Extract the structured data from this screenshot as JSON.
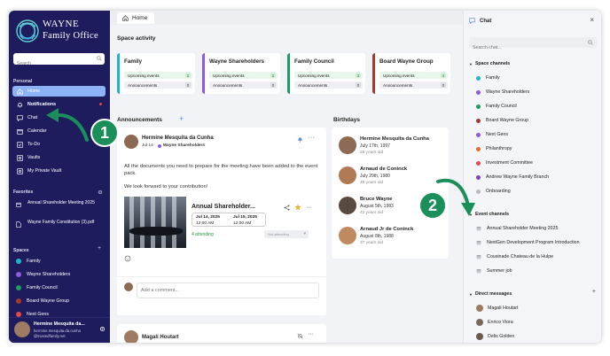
{
  "sidebar": {
    "logo_line1": "WAYNE",
    "logo_line2": "Family Office",
    "search_placeholder": "Search",
    "personal_heading": "Personal",
    "nav": [
      {
        "label": "Home",
        "icon": "home-icon"
      },
      {
        "label": "Notifications",
        "icon": "bell-icon"
      },
      {
        "label": "Chat",
        "icon": "chat-icon"
      },
      {
        "label": "Calendar",
        "icon": "calendar-icon"
      },
      {
        "label": "To-Do",
        "icon": "todo-icon"
      },
      {
        "label": "Vaults",
        "icon": "vault-icon"
      },
      {
        "label": "My Private Vault",
        "icon": "vault-icon"
      }
    ],
    "favorites_heading": "Favorites",
    "favorites": [
      {
        "label": "Annual Shareholder Meeting 2025",
        "icon": "calendar-icon"
      },
      {
        "label": "Wayne Family Constitution (3).pdf",
        "icon": "file-icon"
      }
    ],
    "spaces_heading": "Spaces",
    "spaces": [
      {
        "label": "Family",
        "color": "#1fb5c8"
      },
      {
        "label": "Wayne Shareholders",
        "color": "#8e5cd9"
      },
      {
        "label": "Family Council",
        "color": "#1f9c63"
      },
      {
        "label": "Board Wayne Group",
        "color": "#a33a2c"
      },
      {
        "label": "Next Gens",
        "color": "#e0494a"
      }
    ],
    "user": {
      "name": "Hermine Mesquita da...",
      "email_line1": "hermine.mesquita.da.cunha",
      "email_line2": "@trustedfamily.net"
    }
  },
  "main": {
    "tab_home": "Home",
    "space_activity_title": "Space activity",
    "space_cards": [
      {
        "name": "Family",
        "color": "#1fb5c8",
        "upcoming_label": "Upcoming events",
        "upcoming": "2",
        "ann_label": "Announcements",
        "ann": "0"
      },
      {
        "name": "Wayne Shareholders",
        "color": "#8e5cd9",
        "upcoming_label": "Upcoming events",
        "upcoming": "2",
        "ann_label": "Announcements",
        "ann": "0"
      },
      {
        "name": "Family Council",
        "color": "#1f9c63",
        "upcoming_label": "Upcoming events",
        "upcoming": "3",
        "ann_label": "Announcements",
        "ann": "0"
      },
      {
        "name": "Board Wayne Group",
        "color": "#a33a2c",
        "upcoming_label": "Upcoming events",
        "upcoming": "4",
        "ann_label": "Announcements",
        "ann": "0"
      }
    ],
    "announcements_title": "Announcements",
    "announcements_add": "+",
    "announcement": {
      "author": "Hermine Mesquita da Cunha",
      "date": "Jul 14",
      "space": "Wayne Shareholders",
      "body1": "All the documents you need to prepare for the meeting have been added to the event pack.",
      "body2": "We look forward to your contribution!",
      "event_title": "Annual Shareholder...",
      "start_date": "Jul 14, 2025",
      "start_time": "12:00 AM",
      "end_date": "Jul 15, 2025",
      "end_time": "12:00 AM",
      "attending": "4 attending",
      "rsvp": "Not attending",
      "comment_placeholder": "Add a comment..."
    },
    "announcement2_author": "Magali Houtart",
    "birthdays_title": "Birthdays",
    "birthdays": [
      {
        "name": "Hermine Mesquita da Cunha",
        "date": "July 17th, 1997",
        "age": "28 years old",
        "color": "#8c6a53"
      },
      {
        "name": "Arnaud de Coninck",
        "date": "July 29th, 1980",
        "age": "45 years old",
        "color": "#b07a55"
      },
      {
        "name": "Bruce Wayne",
        "date": "August 5th, 1983",
        "age": "42 years old",
        "color": "#5a4a40"
      },
      {
        "name": "Arnaud Jr de Coninck",
        "date": "August 8th, 1988",
        "age": "37 years old",
        "color": "#c08a60"
      }
    ]
  },
  "chat": {
    "title": "Chat",
    "close": "×",
    "search_placeholder": "Search chat...",
    "space_channels_title": "Space channels",
    "space_channels": [
      {
        "label": "Family",
        "color": "#1fb5c8"
      },
      {
        "label": "Wayne Shareholders",
        "color": "#8e5cd9"
      },
      {
        "label": "Family Council",
        "color": "#1f9c63"
      },
      {
        "label": "Board Wayne Group",
        "color": "#a33a2c"
      },
      {
        "label": "Next Gens",
        "color": "#8e5cd9"
      },
      {
        "label": "Philanthropy",
        "color": "#e06a2a"
      },
      {
        "label": "Investment Committee",
        "color": "#e0494a"
      },
      {
        "label": "Andrew Wayne Family Branch",
        "color": "#7a3fc9"
      },
      {
        "label": "Onboarding",
        "color": "#b9b9c2"
      }
    ],
    "event_channels_title": "Event channels",
    "event_channels": [
      {
        "label": "Annual Shareholder Meeting 2025"
      },
      {
        "label": "NextGen Development Program Introduction"
      },
      {
        "label": "Cousinade Chateau de la Hulpe"
      },
      {
        "label": "Summer job"
      }
    ],
    "dm_title": "Direct messages",
    "dm_add": "+",
    "direct_messages": [
      {
        "label": "Magali Houtart",
        "color": "#a07a60"
      },
      {
        "label": "Enrico Viora",
        "color": "#7a6a5a"
      },
      {
        "label": "Delis Golden",
        "color": "#6a5a4a"
      }
    ]
  },
  "callouts": {
    "one": "1",
    "two": "2"
  }
}
